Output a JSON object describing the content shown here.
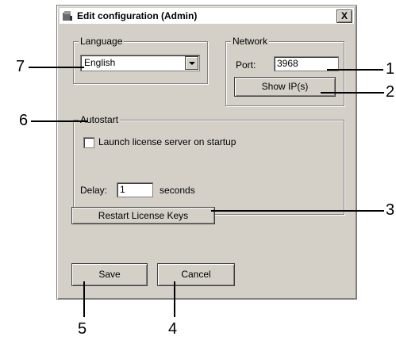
{
  "dialog": {
    "title": "Edit configuration (Admin)",
    "close_label": "X"
  },
  "language_group": {
    "legend": "Language",
    "selected": "English"
  },
  "network_group": {
    "legend": "Network",
    "port_label": "Port:",
    "port_value": "3968",
    "show_ip_label": "Show IP(s)"
  },
  "autostart_group": {
    "legend": "Autostart",
    "checkbox_label": "Launch license server on startup",
    "checkbox_checked": false,
    "delay_label": "Delay:",
    "delay_value": "1",
    "delay_unit": "seconds"
  },
  "buttons": {
    "restart_label": "Restart License Keys",
    "save_label": "Save",
    "cancel_label": "Cancel"
  },
  "callouts": {
    "c1": "1",
    "c2": "2",
    "c3": "3",
    "c4": "4",
    "c5": "5",
    "c6": "6",
    "c7": "7"
  }
}
